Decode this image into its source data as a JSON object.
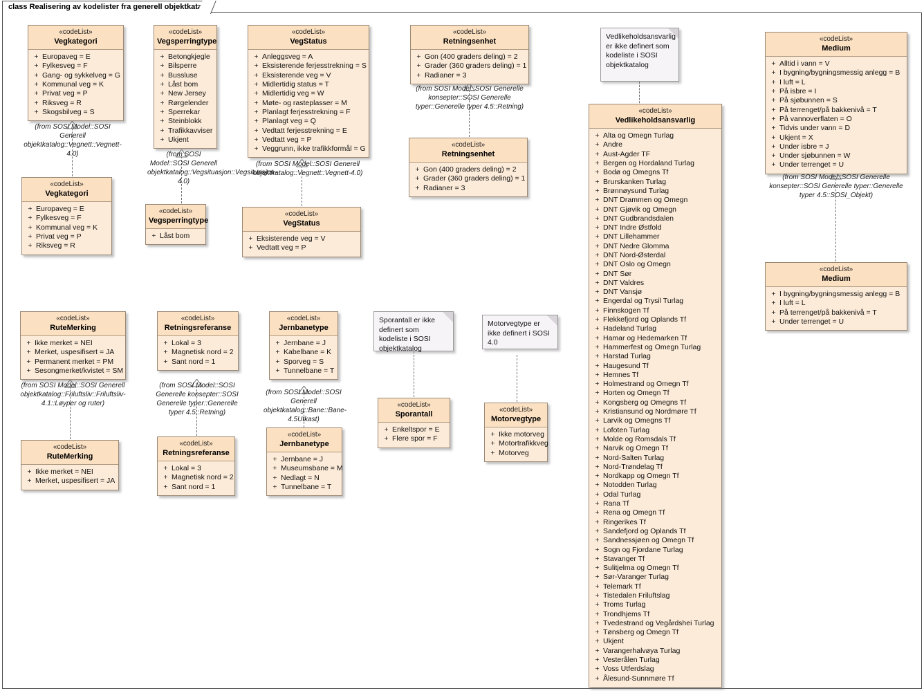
{
  "frame": {
    "tab_label": "class Realisering av kodelister fra generell objektkatalog"
  },
  "stereotype": "«codeList»",
  "classes": {
    "vegkategori_top": {
      "name": "Vegkategori",
      "attrs": [
        "Europaveg = E",
        "Fylkesveg = F",
        "Gang- og sykkelveg = G",
        "Kommunal veg = K",
        "Privat veg = P",
        "Riksveg = R",
        "Skogsbilveg = S"
      ]
    },
    "vegkategori_bottom": {
      "name": "Vegkategori",
      "attrs": [
        "Europaveg = E",
        "Fylkesveg = F",
        "Kommunal veg = K",
        "Privat veg = P",
        "Riksveg = R"
      ]
    },
    "vegsperringtype_top": {
      "name": "Vegsperringtype",
      "attrs": [
        "Betongkjegle",
        "Bilsperre",
        "Bussluse",
        "Låst bom",
        "New Jersey",
        "Rørgelender",
        "Sperrekar",
        "Steinblokk",
        "Trafikkavviser",
        "Ukjent"
      ]
    },
    "vegsperringtype_bottom": {
      "name": "Vegsperringtype",
      "attrs": [
        "Låst bom"
      ]
    },
    "vegstatus_top": {
      "name": "VegStatus",
      "attrs": [
        "Anleggsveg = A",
        "Eksisterende ferjesstrekning = S",
        "Eksisterende veg = V",
        "Midlertidig status = T",
        "Midlertidig veg = W",
        "Møte- og rasteplasser = M",
        "Planlagt ferjesstrekning = F",
        "Planlagt veg = Q",
        "Vedtatt ferjesstrekning = E",
        "Vedtatt veg  = P",
        "Veggrunn, ikke trafikkformål = G"
      ]
    },
    "vegstatus_bottom": {
      "name": "VegStatus",
      "attrs": [
        "Eksisterende veg = V",
        "Vedtatt veg  = P"
      ]
    },
    "retningsenhet_top": {
      "name": "Retningsenhet",
      "attrs": [
        "Gon (400 graders deling) = 2",
        "Grader (360 graders deling) = 1",
        "Radianer = 3"
      ]
    },
    "retningsenhet_bottom": {
      "name": "Retningsenhet",
      "attrs": [
        "Gon (400 graders deling) = 2",
        "Grader (360 graders deling) = 1",
        "Radianer = 3"
      ]
    },
    "vedlikeholdsansvarlig": {
      "name": "Vedlikeholdsansvarlig",
      "attrs": [
        "Alta og Omegn Turlag",
        "Andre",
        "Aust-Agder TF",
        "Bergen og Hordaland Turlag",
        "Bodø og Omegns Tf",
        "Brurskanken Turlag",
        "Brønnøysund Turlag",
        "DNT Drammen og Omegn",
        "DNT Gjøvik og Omegn",
        "DNT Gudbrandsdalen",
        "DNT Indre Østfold",
        "DNT Lillehammer",
        "DNT Nedre Glomma",
        "DNT Nord-Østerdal",
        "DNT Oslo og Omegn",
        "DNT Sør",
        "DNT Valdres",
        "DNT Vansjø",
        "Engerdal og Trysil Turlag",
        "Finnskogen Tf",
        "Flekkefjord og Oplands Tf",
        "Hadeland Turlag",
        "Hamar og Hedemarken Tf",
        "Hammerfest og Omegn Turlag",
        "Harstad Turlag",
        "Haugesund Tf",
        "Hemnes Tf",
        "Holmestrand og Omegn Tf",
        "Horten og Omegn Tf",
        "Kongsberg og Omegns Tf",
        "Kristiansund og Nordmøre Tf",
        "Larvik og Omegns Tf",
        "Lofoten Turlag",
        "Molde og Romsdals Tf",
        "Narvik og Omegn Tf",
        "Nord-Salten Turlag",
        "Nord-Trøndelag Tf",
        "Nordkapp og Omegn Tf",
        "Notodden Turlag",
        "Odal Turlag",
        "Rana Tf",
        "Rena og Omegn Tf",
        "Ringerikes Tf",
        "Sandefjord og Oplands Tf",
        "Sandnessjøen og Omegn Tf",
        "Sogn og Fjordane Turlag",
        "Stavanger Tf",
        "Sulitjelma og Omegn Tf",
        "Sør-Varanger Turlag",
        "Telemark Tf",
        "Tistedalen Friluftslag",
        "Troms Turlag",
        "Trondhjems Tf",
        "Tvedestrand og Vegårdshei Turlag",
        "Tønsberg og Omegn Tf",
        "Ukjent",
        "Varangerhalvøya Turlag",
        "Vesterålen Turlag",
        "Voss Utferdslag",
        "Ålesund-Sunnmøre Tf"
      ]
    },
    "medium_top": {
      "name": "Medium",
      "attrs": [
        "Alltid i vann = V",
        "I bygning/bygningsmessig anlegg = B",
        "I luft = L",
        "På isbre = I",
        "På sjøbunnen = S",
        "På terrenget/på bakkenivå = T",
        "På vannoverflaten = O",
        "Tidvis under vann = D",
        "Ukjent = X",
        "Under isbre = J",
        "Under sjøbunnen = W",
        "Under terrenget = U"
      ]
    },
    "medium_bottom": {
      "name": "Medium",
      "attrs": [
        "I bygning/bygningsmessig anlegg = B",
        "I luft = L",
        "På terrenget/på bakkenivå = T",
        "Under terrenget = U"
      ]
    },
    "rutemerking_top": {
      "name": "RuteMerking",
      "attrs": [
        "Ikke merket = NEI",
        "Merket, uspesifisert = JA",
        "Permanent merket = PM",
        "Sesongmerket/kvistet = SM"
      ]
    },
    "rutemerking_bottom": {
      "name": "RuteMerking",
      "attrs": [
        "Ikke merket = NEI",
        "Merket, uspesifisert = JA"
      ]
    },
    "retningsreferanse_top": {
      "name": "Retningsreferanse",
      "attrs": [
        "Lokal = 3",
        "Magnetisk nord = 2",
        "Sant nord = 1"
      ]
    },
    "retningsreferanse_bottom": {
      "name": "Retningsreferanse",
      "attrs": [
        "Lokal = 3",
        "Magnetisk nord = 2",
        "Sant nord = 1"
      ]
    },
    "jernbanetype_top": {
      "name": "Jernbanetype",
      "attrs": [
        "Jernbane = J",
        "Kabelbane = K",
        "Sporveg = S",
        "Tunnelbane = T"
      ]
    },
    "jernbanetype_bottom": {
      "name": "Jernbanetype",
      "attrs": [
        "Jernbane = J",
        "Museumsbane = M",
        "Nedlagt = N",
        "Tunnelbane = T"
      ]
    },
    "sporantall": {
      "name": "Sporantall",
      "attrs": [
        "Enkeltspor = E",
        "Flere spor = F"
      ]
    },
    "motorvegtype": {
      "name": "Motorvegtype",
      "attrs": [
        "Ikke motorveg",
        "Motortrafikkveg",
        "Motorveg"
      ]
    }
  },
  "from_labels": {
    "vegkategori": "(from SOSI Model::SOSI Generell objektkatalog::Vegnett::Vegnett-4.0)",
    "vegsperringtype": "(from SOSI Model::SOSI Generell objektkatalog::Vegsituasjon::Vegsituasjon-4.0)",
    "vegstatus": "(from SOSI Model::SOSI Generell objektkatalog::Vegnett::Vegnett-4.0)",
    "retningsenhet": "(from SOSI Model::SOSI Generelle konsepter::SOSI Generelle typer::Generelle typer 4.5::Retning)",
    "medium": "(from SOSI Model::SOSI Generelle konsepter::SOSI Generelle typer::Generelle typer 4.5::SOSI_Objekt)",
    "rutemerking": "(from SOSI Model::SOSI Generell objektkatalog::Friluftsliv::Friluftsliv-4.1::Løyper og ruter)",
    "retningsreferanse": "(from SOSI Model::SOSI Generelle konsepter::SOSI Generelle typer::Generelle typer 4.5::Retning)",
    "jernbanetype": "(from SOSI Model::SOSI Generell objektkatalog::Bane::Bane-4.5Utkast)"
  },
  "notes": {
    "vedlikeholdsansvarlig": "Vedlikeholdsansvarlig er ikke definert som kodeliste i SOSI objektkatalog",
    "sporantall": "Sporantall er ikke definert som kodeliste i SOSI objektkatalog",
    "motorvegtype": "Motorvegtype er ikke definert i SOSI 4.0"
  },
  "colors": {
    "class_header": "#fbe0c2",
    "class_body": "#fcebd8",
    "class_border": "#9a8875",
    "note_bg": "#f7f4f8",
    "connector": "#6d6d6d"
  }
}
